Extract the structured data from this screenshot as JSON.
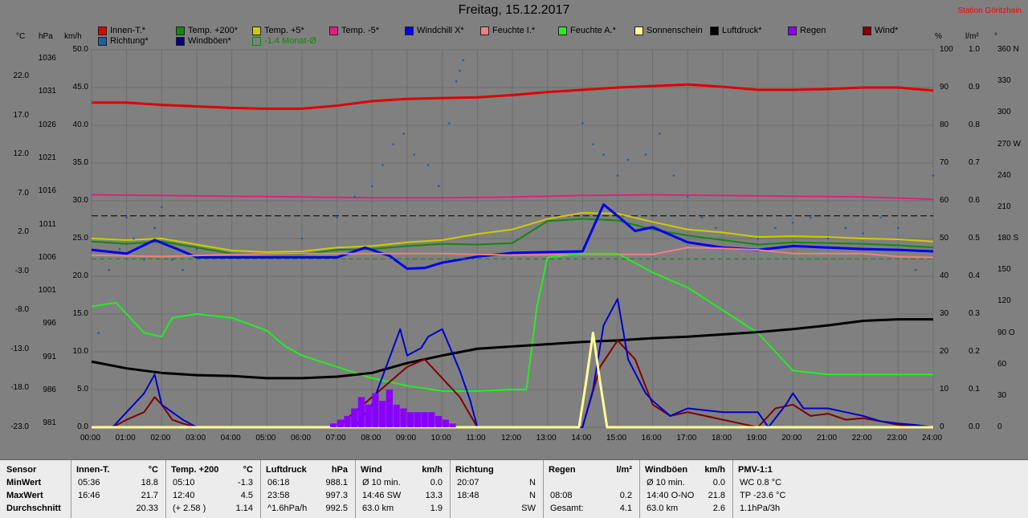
{
  "title": "Freitag, 15.12.2017",
  "station": "Station Göritzhain",
  "legend": [
    {
      "label": "Innen-T.*",
      "color": "#e00000"
    },
    {
      "label": "Temp. +200*",
      "color": "#118811"
    },
    {
      "label": "Temp. +5*",
      "color": "#cccc00"
    },
    {
      "label": "Temp. -5*",
      "color": "#e0207a"
    },
    {
      "label": "Windchill X*",
      "color": "#0000ee"
    },
    {
      "label": "Feuchte I.*",
      "color": "#f08080"
    },
    {
      "label": "Feuchte A.*",
      "color": "#22ee22"
    },
    {
      "label": "Sonnenschein",
      "color": "#ffff99"
    },
    {
      "label": "Luftdruck*",
      "color": "#000000"
    },
    {
      "label": "Regen",
      "color": "#8a00ff"
    },
    {
      "label": "Wind*",
      "color": "#800000"
    },
    {
      "label": "Richtung*",
      "color": "#1f5f9f"
    },
    {
      "label": "Windböen*",
      "color": "#000080"
    },
    {
      "label": "-1.4 Monat-Ø",
      "color": "#0b8a0b"
    }
  ],
  "units": {
    "c": "°C",
    "hpa": "hPa",
    "kmh": "km/h",
    "pct": "%",
    "lm2": "l/m²",
    "deg": "°"
  },
  "axes": {
    "celsius": [
      "22.0",
      "17.0",
      "12.0",
      "7.0",
      "2.0",
      "-3.0",
      "-8.0",
      "-13.0",
      "-18.0",
      "-23.0"
    ],
    "hpa": [
      "1036",
      "1031",
      "1026",
      "1021",
      "1016",
      "1011",
      "1006",
      "1001",
      "996",
      "991",
      "986",
      "981"
    ],
    "kmh": [
      "50.0",
      "45.0",
      "40.0",
      "35.0",
      "30.0",
      "25.0",
      "20.0",
      "15.0",
      "10.0",
      "5.0",
      "0.0"
    ],
    "pct": [
      "100",
      "90",
      "80",
      "70",
      "60",
      "50",
      "40",
      "30",
      "20",
      "10",
      "0"
    ],
    "lm2": [
      "1.0",
      "0.9",
      "0.8",
      "0.7",
      "0.6",
      "0.5",
      "0.4",
      "0.3",
      "0.2",
      "0.1",
      "0.0"
    ],
    "deg": [
      "360 N",
      "330",
      "300",
      "270 W",
      "240",
      "210",
      "180 S",
      "150",
      "120",
      "90 O",
      "60",
      "30",
      "0"
    ],
    "time": [
      "00:00",
      "01:00",
      "02:00",
      "03:00",
      "04:00",
      "05:00",
      "06:00",
      "07:00",
      "08:00",
      "09:00",
      "10:00",
      "11:00",
      "12:00",
      "13:00",
      "14:00",
      "15:00",
      "16:00",
      "17:00",
      "18:00",
      "19:00",
      "20:00",
      "21:00",
      "22:00",
      "23:00",
      "24:00"
    ]
  },
  "chart_data": {
    "type": "line",
    "title": "Freitag, 15.12.2017",
    "x_unit": "hours",
    "kmh_range": [
      0,
      50
    ],
    "grid": true,
    "series": [
      {
        "name": "Innen-T.*",
        "color": "#e00000",
        "axis": "kmh",
        "x": [
          0,
          1,
          2,
          3,
          4,
          5,
          6,
          7,
          8,
          9,
          10,
          11,
          12,
          13,
          14,
          15,
          16,
          17,
          18,
          19,
          20,
          21,
          22,
          23,
          24
        ],
        "y": [
          43.0,
          43.0,
          42.7,
          42.5,
          42.3,
          42.2,
          42.2,
          42.6,
          43.2,
          43.5,
          43.6,
          43.7,
          44.0,
          44.4,
          44.7,
          45.0,
          45.2,
          45.4,
          45.1,
          44.7,
          44.7,
          44.8,
          45.0,
          45.0,
          44.6
        ]
      },
      {
        "name": "Temp. -5*",
        "color": "#e0207a",
        "axis": "kmh",
        "x": [
          0,
          2,
          4,
          6,
          8,
          10,
          12,
          14,
          16,
          18,
          20,
          22,
          24
        ],
        "y": [
          30.8,
          30.7,
          30.6,
          30.5,
          30.4,
          30.4,
          30.5,
          30.7,
          30.8,
          30.7,
          30.6,
          30.5,
          30.2
        ]
      },
      {
        "name": "Temp. +5*",
        "color": "#cccc00",
        "axis": "kmh",
        "x": [
          0,
          1,
          2,
          3,
          4,
          5,
          6,
          7,
          8,
          9,
          10,
          11,
          12,
          13,
          14,
          15,
          16,
          17,
          18,
          19,
          20,
          21,
          22,
          23,
          24
        ],
        "y": [
          25.0,
          24.8,
          25.0,
          24.2,
          23.4,
          23.2,
          23.3,
          23.8,
          24.0,
          24.5,
          24.8,
          25.6,
          26.2,
          27.6,
          28.4,
          28.3,
          27.2,
          26.2,
          25.8,
          25.2,
          25.3,
          25.2,
          25.0,
          24.9,
          24.6
        ]
      },
      {
        "name": "Temp. +200*",
        "color": "#118811",
        "axis": "kmh",
        "x": [
          0,
          1,
          2,
          3,
          4,
          5,
          6,
          7,
          8,
          9,
          10,
          11,
          12,
          13,
          14,
          15,
          16,
          17,
          18,
          19,
          20,
          21,
          22,
          23,
          24
        ],
        "y": [
          24.6,
          24.3,
          24.6,
          23.8,
          23.0,
          22.9,
          22.9,
          23.5,
          23.6,
          24.0,
          24.3,
          24.2,
          24.4,
          27.3,
          27.6,
          27.4,
          26.2,
          25.4,
          24.8,
          24.2,
          24.5,
          24.4,
          24.3,
          24.1,
          23.8
        ]
      },
      {
        "name": "Windchill X*",
        "color": "#0000ee",
        "axis": "kmh",
        "x": [
          0,
          1,
          1.8,
          2.5,
          3,
          4,
          5,
          6,
          7,
          7.8,
          8.5,
          9,
          9.5,
          10,
          11,
          12,
          13,
          14,
          14.6,
          15,
          15.5,
          16,
          16.5,
          17,
          18,
          19,
          20,
          21,
          22,
          23,
          24
        ],
        "y": [
          23.5,
          23.0,
          24.8,
          23.5,
          22.5,
          22.5,
          22.5,
          22.5,
          22.5,
          23.8,
          22.7,
          21.0,
          21.1,
          21.8,
          22.6,
          23.1,
          23.2,
          23.3,
          29.5,
          28.0,
          26.0,
          26.5,
          25.5,
          24.5,
          23.8,
          23.5,
          24.0,
          23.8,
          23.6,
          23.5,
          23.3
        ]
      },
      {
        "name": "Feuchte I.*",
        "color": "#f08080",
        "axis": "kmh",
        "x": [
          0,
          2,
          4,
          6,
          8,
          10,
          12,
          14,
          16,
          17,
          18,
          19,
          20,
          22,
          23,
          24
        ],
        "y": [
          22.8,
          22.6,
          22.9,
          23.0,
          23.0,
          23.0,
          22.8,
          22.9,
          22.9,
          23.8,
          23.7,
          23.5,
          23.0,
          23.0,
          22.6,
          22.5
        ]
      },
      {
        "name": "Feuchte A.*",
        "color": "#22ee22",
        "axis": "kmh",
        "x": [
          0,
          0.7,
          1,
          1.5,
          2,
          2.3,
          3,
          4,
          5,
          5.5,
          6,
          7,
          8,
          9,
          10,
          11,
          12,
          12.4,
          12.7,
          13,
          14,
          15,
          16,
          17,
          18,
          19,
          20,
          21,
          22,
          23,
          24
        ],
        "y": [
          16.0,
          16.5,
          15.0,
          12.5,
          12.0,
          14.5,
          15.0,
          14.5,
          12.8,
          10.8,
          9.5,
          8.0,
          6.5,
          5.5,
          4.8,
          4.8,
          5.0,
          5.0,
          16.0,
          22.5,
          23.0,
          23.0,
          20.5,
          18.5,
          15.5,
          12.5,
          7.5,
          7.0,
          7.0,
          7.0,
          7.0
        ]
      },
      {
        "name": "Luftdruck*",
        "color": "#000000",
        "axis": "kmh",
        "x": [
          0,
          1,
          2,
          3,
          4,
          5,
          6,
          7,
          8,
          9,
          10,
          11,
          12,
          13,
          14,
          15,
          16,
          17,
          18,
          19,
          20,
          21,
          22,
          23,
          24
        ],
        "y": [
          8.7,
          7.8,
          7.2,
          6.9,
          6.8,
          6.5,
          6.5,
          6.7,
          7.2,
          8.5,
          9.5,
          10.4,
          10.7,
          11.0,
          11.3,
          11.5,
          11.8,
          12.0,
          12.3,
          12.6,
          13.0,
          13.5,
          14.1,
          14.3,
          14.3
        ]
      },
      {
        "name": "Wind*",
        "color": "#800000",
        "axis": "kmh",
        "x": [
          0,
          0.6,
          1,
          1.5,
          1.8,
          2,
          2.3,
          2.6,
          3,
          7,
          8,
          8.5,
          9,
          9.5,
          10,
          10.5,
          11,
          13,
          14,
          14.5,
          15,
          15.5,
          16,
          16.5,
          17,
          18,
          18.5,
          19,
          19.5,
          20,
          20.5,
          21,
          21.5,
          22,
          22.5,
          23,
          24
        ],
        "y": [
          0,
          0,
          1.0,
          2.0,
          4.0,
          3.0,
          1.0,
          0.5,
          0,
          0,
          4.0,
          6.0,
          8.0,
          9.0,
          6.5,
          4.0,
          0,
          0,
          0,
          8.0,
          11.5,
          9.0,
          3.0,
          1.5,
          2.0,
          1.0,
          0.5,
          0,
          2.5,
          3.0,
          1.5,
          1.8,
          1.0,
          1.2,
          0.8,
          0.3,
          0
        ]
      },
      {
        "name": "Windböen*",
        "color": "#0000cc",
        "axis": "kmh",
        "x": [
          0,
          0.6,
          1,
          1.4,
          1.5,
          1.8,
          2,
          2.3,
          2.6,
          3,
          7.5,
          8,
          8.4,
          8.8,
          9,
          9.4,
          9.6,
          10,
          10.5,
          10.8,
          11,
          13,
          14,
          14.3,
          14.6,
          15,
          15.3,
          15.8,
          16,
          16.5,
          17,
          18,
          19,
          19.3,
          19.8,
          20,
          20.3,
          21,
          21.5,
          22,
          22.5,
          23,
          23.5,
          24
        ],
        "y": [
          0,
          0,
          2.0,
          4.0,
          4.5,
          7.0,
          3.0,
          2.0,
          1.0,
          0,
          0,
          3.0,
          8.0,
          13.0,
          9.5,
          10.5,
          12.0,
          13.0,
          7.5,
          3.5,
          0,
          0,
          0,
          5.0,
          13.5,
          17.0,
          9.0,
          4.5,
          3.5,
          1.5,
          2.5,
          2.0,
          2.0,
          0,
          3.0,
          4.5,
          2.5,
          2.5,
          2.0,
          1.5,
          0.8,
          0.5,
          0.3,
          0
        ]
      },
      {
        "name": "Sonnenschein",
        "color": "#ffff99",
        "axis": "kmh",
        "x": [
          0,
          13.9,
          14.1,
          14.3,
          14.5,
          14.7,
          24
        ],
        "y": [
          0,
          0,
          6,
          12.5,
          6,
          0,
          0
        ]
      },
      {
        "name": "Regen",
        "color": "#8a00ff",
        "axis": "lm2",
        "type": "bar",
        "x": [
          6.8,
          7,
          7.2,
          7.4,
          7.6,
          7.8,
          8,
          8.2,
          8.4,
          8.6,
          8.8,
          9,
          9.2,
          9.4,
          9.6,
          9.8,
          10,
          10.2
        ],
        "y": [
          0.01,
          0.02,
          0.03,
          0.05,
          0.08,
          0.06,
          0.09,
          0.07,
          0.1,
          0.06,
          0.05,
          0.04,
          0.04,
          0.04,
          0.04,
          0.03,
          0.02,
          0.01
        ]
      },
      {
        "name": "Richtung*",
        "color": "#1f5f9f",
        "axis": "deg",
        "type": "scatter",
        "x": [
          0.2,
          0.5,
          0.8,
          1,
          1.2,
          1.5,
          1.8,
          2,
          2.3,
          2.6,
          3,
          6,
          7,
          7.5,
          8,
          8.3,
          8.6,
          8.9,
          9.2,
          9.6,
          9.9,
          10.2,
          10.4,
          10.5,
          10.6,
          14,
          14.3,
          14.6,
          15,
          15.3,
          15.8,
          16.2,
          16.6,
          17,
          17.4,
          17.8,
          19,
          19.5,
          20,
          20.5,
          21,
          21.5,
          22,
          22.5,
          23,
          23.5,
          24
        ],
        "y": [
          90,
          150,
          170,
          200,
          180,
          160,
          190,
          210,
          160,
          150,
          170,
          180,
          200,
          220,
          230,
          250,
          270,
          280,
          260,
          250,
          230,
          290,
          330,
          340,
          350,
          290,
          270,
          260,
          240,
          255,
          260,
          280,
          240,
          220,
          200,
          190,
          180,
          190,
          195,
          200,
          180,
          190,
          185,
          200,
          190,
          150,
          240
        ]
      },
      {
        "name": "-1.4 Monat-Ø",
        "color": "#0b8a0b",
        "axis": "kmh",
        "type": "ref",
        "y": 22.3
      }
    ],
    "ref_line_dashed_black": 28.0
  },
  "table": {
    "rowlabels": [
      "Sensor",
      "MinWert",
      "MaxWert",
      "Durchschnitt"
    ],
    "cols": [
      {
        "h1": "Innen-T.",
        "h2": "°C",
        "r": [
          [
            "05:36",
            "18.8"
          ],
          [
            "16:46",
            "21.7"
          ],
          [
            "",
            "20.33"
          ]
        ]
      },
      {
        "h1": "Temp. +200",
        "h2": "°C",
        "r": [
          [
            "05:10",
            "-1.3"
          ],
          [
            "12:40",
            "4.5"
          ],
          [
            "(+ 2.58 )",
            "1.14"
          ]
        ]
      },
      {
        "h1": "Luftdruck",
        "h2": "hPa",
        "r": [
          [
            "06:18",
            "988.1"
          ],
          [
            "23:58",
            "997.3"
          ],
          [
            "^1.6hPa/h",
            "992.5"
          ]
        ]
      },
      {
        "h1": "Wind",
        "h2": "km/h",
        "r": [
          [
            "Ø 10 min.",
            "0.0"
          ],
          [
            "14:46  SW",
            "13.3"
          ],
          [
            "63.0 km",
            "1.9"
          ]
        ]
      },
      {
        "h1": "Richtung",
        "h2": "",
        "r": [
          [
            "20:07",
            "N"
          ],
          [
            "18:48",
            "N"
          ],
          [
            "",
            "SW"
          ]
        ]
      },
      {
        "h1": "Regen",
        "h2": "l/m²",
        "r": [
          [
            "",
            ""
          ],
          [
            "08:08",
            "0.2"
          ],
          [
            "Gesamt:",
            "4.1"
          ]
        ]
      },
      {
        "h1": "Windböen",
        "h2": "km/h",
        "r": [
          [
            "Ø 10 min.",
            "0.0"
          ],
          [
            "14:40  O-NO",
            "21.8"
          ],
          [
            "63.0 km",
            "2.6"
          ]
        ]
      },
      {
        "h1": "PMV-1:1",
        "h2": "",
        "r": [
          [
            "WC 0.8 °C",
            ""
          ],
          [
            "TP -23.6 °C",
            ""
          ],
          [
            "1.1hPa/3h",
            ""
          ]
        ]
      }
    ]
  }
}
